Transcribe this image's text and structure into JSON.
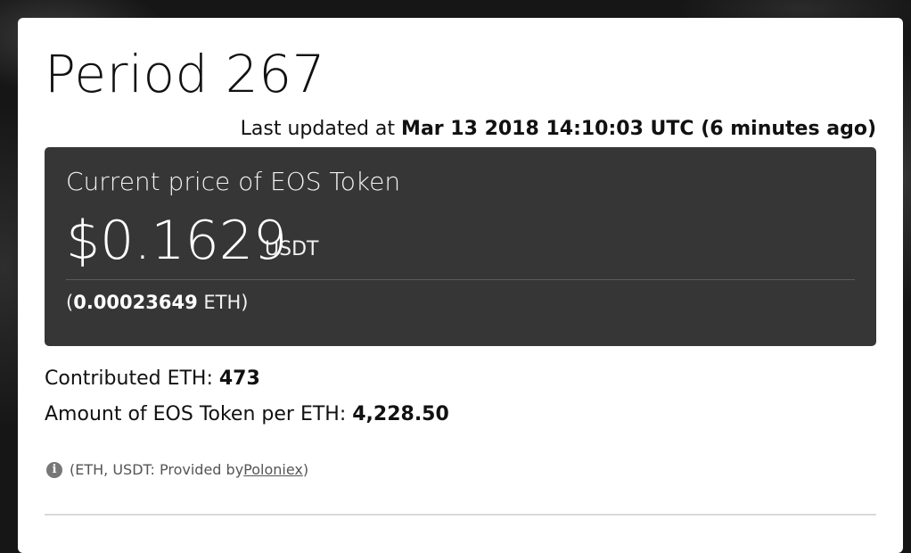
{
  "period": {
    "title": "Period 267"
  },
  "updated": {
    "prefix": "Last updated at ",
    "datetime": "Mar 13 2018 14:10:03 UTC (6 minutes ago)"
  },
  "price": {
    "label": "Current price of EOS Token",
    "value": "$0.1629",
    "unit": "USDT",
    "eth_open": "(",
    "eth_value": "0.00023649",
    "eth_unit": " ETH)"
  },
  "stats": {
    "contributed_label": "Contributed ETH: ",
    "contributed_value": "473",
    "amount_label": "Amount of EOS Token per ETH: ",
    "amount_value": "4,228.50"
  },
  "note": {
    "icon": "info-icon",
    "prefix": "(ETH, USDT: Provided by ",
    "link": "Poloniex",
    "suffix": ")"
  }
}
